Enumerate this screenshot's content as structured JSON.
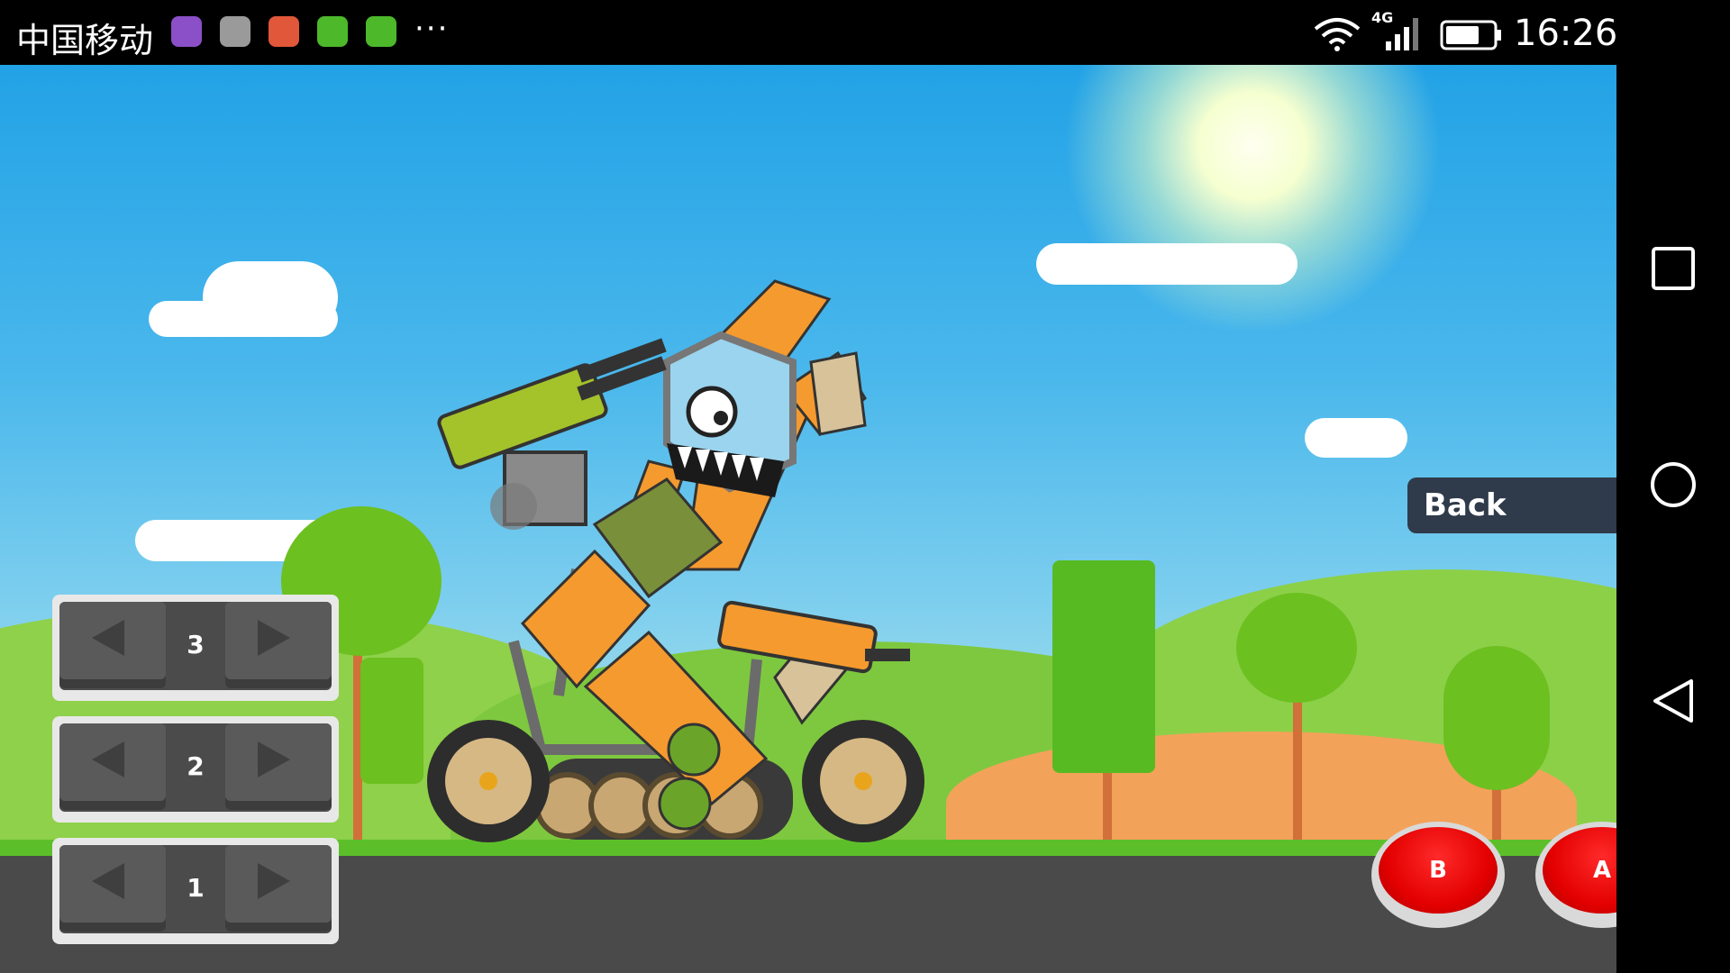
{
  "status_bar": {
    "carrier": "中国移动",
    "network": "4G",
    "time": "16:26",
    "more": "···"
  },
  "game": {
    "back_label": "Back",
    "controls": [
      {
        "value": "3"
      },
      {
        "value": "2"
      },
      {
        "value": "1"
      }
    ],
    "buttons": {
      "b_label": "B",
      "a_label": "A"
    }
  },
  "colors": {
    "sky": "#22a2e6",
    "ground": "#4a4a4a",
    "grass": "#5cbf2a",
    "button_red": "#e30000",
    "tank_orange": "#f59a2e"
  },
  "nav_bar": {
    "icons": [
      "recent-apps-icon",
      "home-icon",
      "back-icon"
    ]
  }
}
